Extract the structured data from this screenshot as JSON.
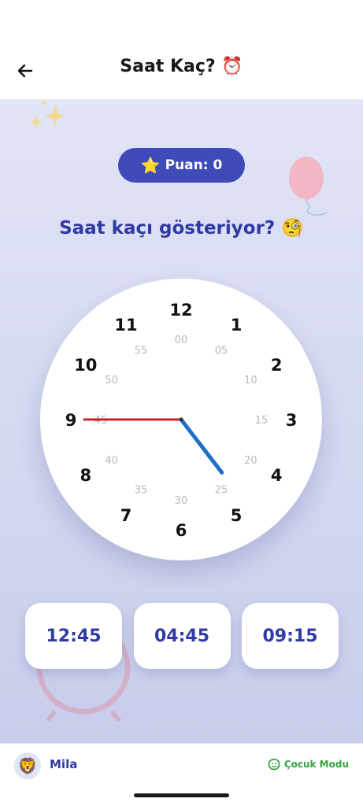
{
  "header": {
    "title": "Saat Kaç?",
    "title_emoji": "⏰"
  },
  "score": {
    "star": "⭐",
    "label": "Puan: 0"
  },
  "question": {
    "text": "Saat kaçı gösteriyor?",
    "emoji": "🧐"
  },
  "clock": {
    "hour_numbers": [
      "12",
      "1",
      "2",
      "3",
      "4",
      "5",
      "6",
      "7",
      "8",
      "9",
      "10",
      "11"
    ],
    "minute_labels": [
      "00",
      "05",
      "10",
      "15",
      "20",
      "25",
      "30",
      "35",
      "40",
      "45",
      "50",
      "55"
    ],
    "hour_value": 4.75,
    "minute_value": 45,
    "colors": {
      "hour_hand": "#1f6fc9",
      "minute_hand": "#cc1f2a",
      "numbers": "#111111",
      "minute_labels": "#b8b8b8"
    }
  },
  "answers": [
    {
      "label": "12:45"
    },
    {
      "label": "04:45"
    },
    {
      "label": "09:15"
    }
  ],
  "footer": {
    "avatar_emoji": "🦁",
    "user_name": "Mila",
    "mode_label": "Çocuk Modu"
  }
}
